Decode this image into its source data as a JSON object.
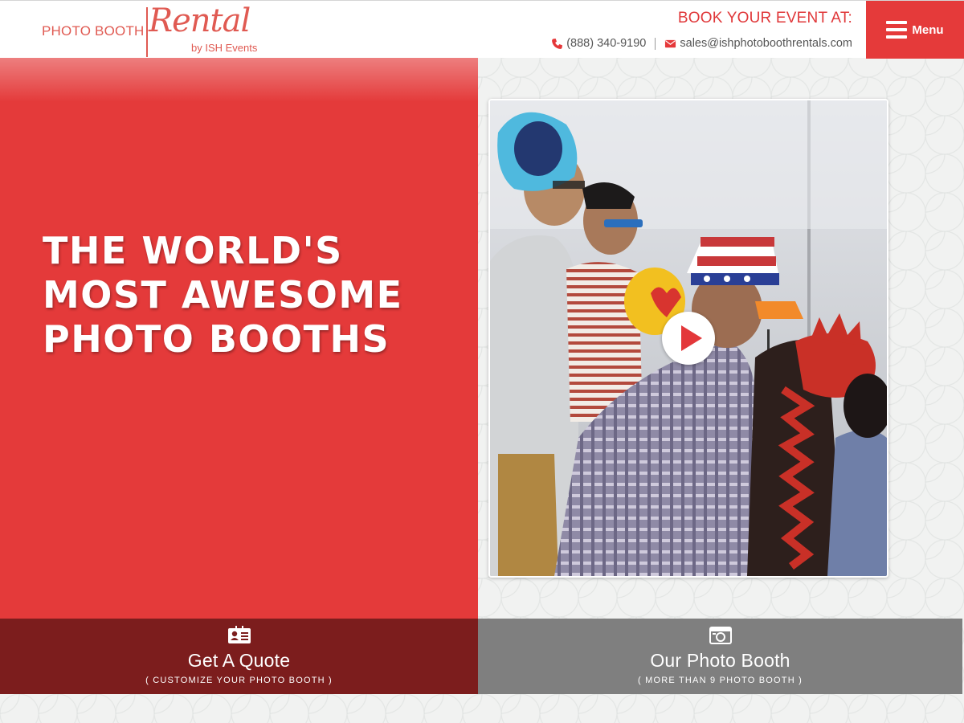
{
  "header": {
    "logo": {
      "photo_booth": "PHOTO BOOTH",
      "rental": "Rental",
      "by": "by ISH Events"
    },
    "book_label": "BOOK YOUR EVENT AT:",
    "phone": "(888) 340-9190",
    "email": "sales@ishphotoboothrentals.com",
    "menu_label": "Menu"
  },
  "hero": {
    "headline_lines": [
      "THE WORLD'S",
      "MOST AWESOME",
      "PHOTO BOOTHS"
    ],
    "video_icon": "play-icon"
  },
  "cta": {
    "quote": {
      "title": "Get A Quote",
      "subtitle": "( CUSTOMIZE YOUR PHOTO BOOTH )",
      "icon": "contact-card-icon"
    },
    "booth": {
      "title": "Our Photo Booth",
      "subtitle": "( MORE THAN 9 PHOTO BOOTH )",
      "icon": "camera-icon"
    }
  },
  "colors": {
    "brand_red": "#e43a3a",
    "dark_red": "#7c1d1d",
    "gray": "#7f7f7f"
  }
}
